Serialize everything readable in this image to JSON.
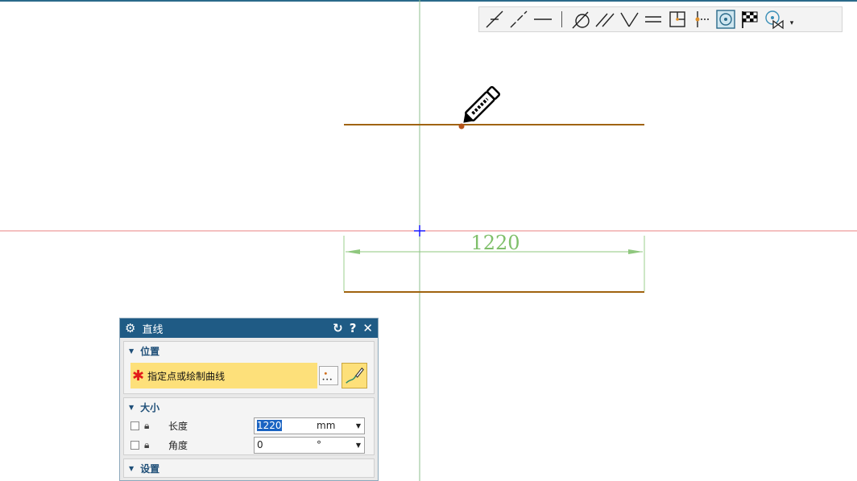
{
  "canvas": {
    "dimension_text": "1220",
    "colors": {
      "line": "#a0630f",
      "dimension": "#7fbf6a",
      "x_axis": "#e88080",
      "y_axis": "#8cbf8c",
      "origin": "#1a1aff"
    }
  },
  "toolbar": {
    "icons": [
      "intersection-point-icon",
      "point-on-line-icon",
      "line-icon",
      "separator",
      "circle-tangent-icon",
      "parallel-lines-icon",
      "angle-lines-icon",
      "equal-lines-icon",
      "midpoint-box-icon",
      "point-on-axis-icon",
      "snap-circle-icon",
      "checkered-flag-icon",
      "snap-circle-bowtie-icon"
    ]
  },
  "dialog": {
    "title": "直线",
    "reset_glyph": "↻",
    "help_glyph": "?",
    "close_glyph": "✕",
    "position": {
      "heading": "位置",
      "select_label": "指定点或绘制曲线",
      "required_mark": "✱"
    },
    "size": {
      "heading": "大小",
      "length_label": "长度",
      "length_value": "1220",
      "length_unit": "mm",
      "angle_label": "角度",
      "angle_value": "0",
      "angle_unit": "°"
    },
    "settings": {
      "heading": "设置"
    }
  }
}
